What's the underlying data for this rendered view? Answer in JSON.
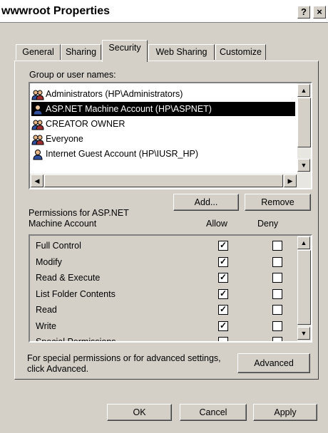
{
  "window": {
    "title": "wwwroot Properties"
  },
  "titlebar_buttons": {
    "help": "?",
    "close": "×"
  },
  "tabs": [
    {
      "label": "General"
    },
    {
      "label": "Sharing"
    },
    {
      "label": "Security"
    },
    {
      "label": "Web Sharing"
    },
    {
      "label": "Customize"
    }
  ],
  "active_tab": "Security",
  "group_label": "Group or user names:",
  "users": [
    {
      "name": "Administrators (HP\\Administrators)",
      "icon": "group-icon",
      "selected": false
    },
    {
      "name": "ASP.NET Machine Account (HP\\ASPNET)",
      "icon": "user-icon",
      "selected": true
    },
    {
      "name": "CREATOR OWNER",
      "icon": "group-icon",
      "selected": false
    },
    {
      "name": "Everyone",
      "icon": "group-icon",
      "selected": false
    },
    {
      "name": "Internet Guest Account (HP\\IUSR_HP)",
      "icon": "user-icon",
      "selected": false
    }
  ],
  "buttons": {
    "add": "Add...",
    "remove": "Remove",
    "advanced": "Advanced",
    "ok": "OK",
    "cancel": "Cancel",
    "apply": "Apply"
  },
  "permissions": {
    "label_line1": "Permissions for ASP.NET",
    "label_line2": "Machine Account",
    "allow_header": "Allow",
    "deny_header": "Deny",
    "rows": [
      {
        "name": "Full Control",
        "allow": true,
        "deny": false
      },
      {
        "name": "Modify",
        "allow": true,
        "deny": false
      },
      {
        "name": "Read & Execute",
        "allow": true,
        "deny": false
      },
      {
        "name": "List Folder Contents",
        "allow": true,
        "deny": false
      },
      {
        "name": "Read",
        "allow": true,
        "deny": false
      },
      {
        "name": "Write",
        "allow": true,
        "deny": false
      },
      {
        "name": "Special Permissions",
        "allow": false,
        "deny": false
      }
    ]
  },
  "advanced_text": {
    "line1": "For special permissions or for advanced settings,",
    "line2": "click Advanced."
  },
  "colors": {
    "face": "#d4d0c8",
    "selection": "#000000"
  }
}
